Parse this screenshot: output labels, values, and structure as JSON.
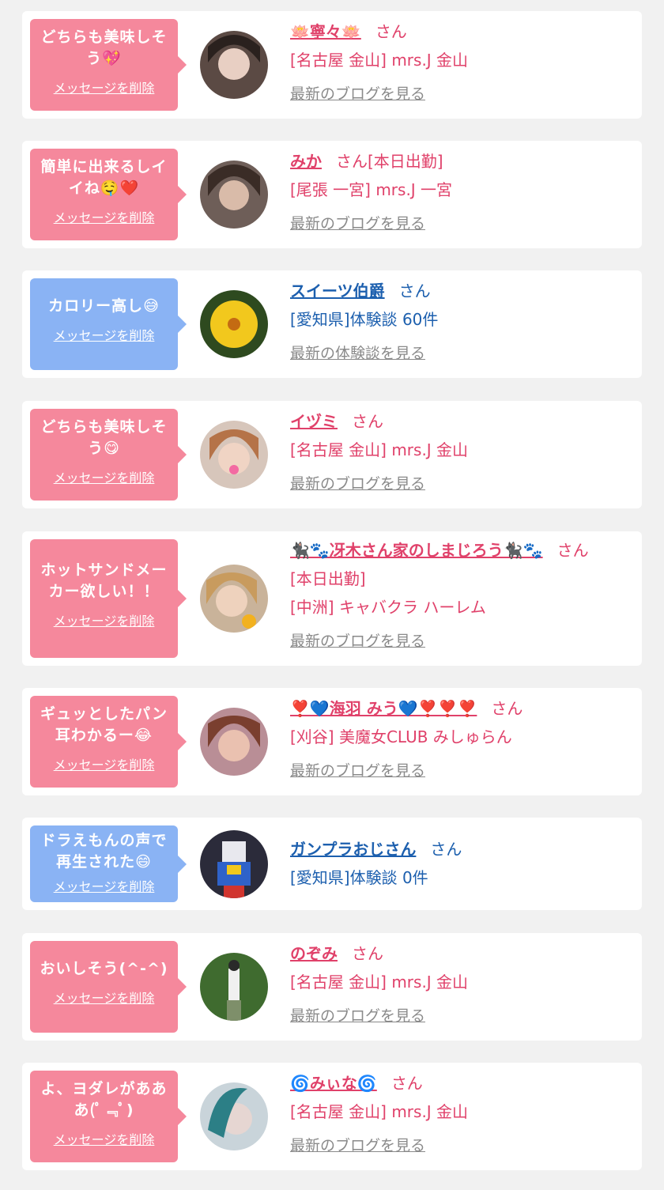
{
  "items": [
    {
      "message": "どちらも美味しそう💖",
      "delete": "メッセージを削除",
      "name": "🪷寧々🪷",
      "san": "さん",
      "lines": [
        "[名古屋 金山] mrs.J 金山"
      ],
      "link": "最新のブログを見る",
      "color": "pink",
      "avatar_color": "#6b5a52"
    },
    {
      "message": "簡単に出来るしイイね🤤❤️",
      "delete": "メッセージを削除",
      "name": "みか",
      "san": "さん[本日出勤]",
      "lines": [
        "[尾張 一宮] mrs.J 一宮"
      ],
      "link": "最新のブログを見る",
      "color": "pink",
      "avatar_color": "#7b6a63"
    },
    {
      "message": "カロリー高し😅",
      "delete": "メッセージを削除",
      "name": "スイーツ伯爵",
      "san": "さん",
      "lines": [
        "[愛知県]体験談 60件"
      ],
      "link": "最新の体験談を見る",
      "color": "blue",
      "avatar_color": "#c7a21a"
    },
    {
      "message": "どちらも美味しそう😋",
      "delete": "メッセージを削除",
      "name": "イヅミ",
      "san": "さん",
      "lines": [
        "[名古屋 金山] mrs.J 金山"
      ],
      "link": "最新のブログを見る",
      "color": "pink",
      "avatar_color": "#c08a6e"
    },
    {
      "message": "ホットサンドメーカー欲しい！！",
      "delete": "メッセージを削除",
      "name": "🐈‍⬛🐾冴木さん家のしまじろう🐈‍⬛🐾",
      "san": "さん",
      "lines": [
        "[本日出勤]",
        "[中洲] キャバクラ ハーレム"
      ],
      "link": "最新のブログを見る",
      "color": "pink",
      "avatar_color": "#c9a27c"
    },
    {
      "message": "ギュッとしたパン耳わかるー😂",
      "delete": "メッセージを削除",
      "name": "❣️💙海羽 みう💙❣️❣️❣️",
      "san": "さん",
      "lines": [
        "[刈谷] 美魔女CLUB みしゅらん"
      ],
      "link": "最新のブログを見る",
      "color": "pink",
      "avatar_color": "#9a6f78"
    },
    {
      "message": "ドラえもんの声で再生された😄",
      "delete": "メッセージを削除",
      "name": "ガンプラおじさん",
      "san": "さん",
      "lines": [
        "[愛知県]体験談 0件"
      ],
      "link": "",
      "color": "blue",
      "avatar_color": "#3b3b55"
    },
    {
      "message": "おいしそう(^-^)",
      "delete": "メッセージを削除",
      "name": "のぞみ",
      "san": "さん",
      "lines": [
        "[名古屋 金山] mrs.J 金山"
      ],
      "link": "最新のブログを見る",
      "color": "pink",
      "avatar_color": "#4d6b3a"
    },
    {
      "message": "よ、ヨダレがあああ(ﾟ﹃ﾟ)",
      "delete": "メッセージを削除",
      "name": "🌀みぃな🌀",
      "san": "さん",
      "lines": [
        "[名古屋 金山] mrs.J 金山"
      ],
      "link": "最新のブログを見る",
      "color": "pink",
      "avatar_color": "#2f3d45"
    }
  ]
}
